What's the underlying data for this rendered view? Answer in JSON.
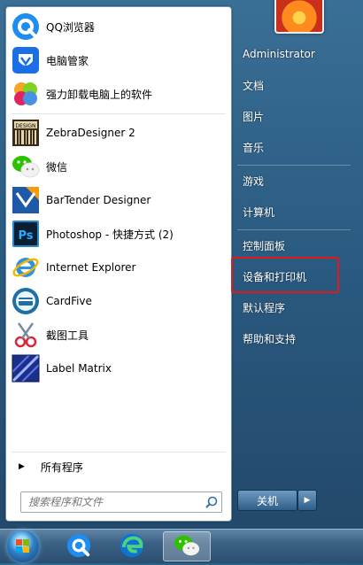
{
  "left_panel": {
    "pinned": [
      {
        "label": "QQ浏览器",
        "icon": "qq-browser-icon"
      },
      {
        "label": "电脑管家",
        "icon": "pc-manager-icon"
      },
      {
        "label": "强力卸载电脑上的软件",
        "icon": "uninstaller-icon"
      }
    ],
    "recent": [
      {
        "label": "ZebraDesigner 2",
        "icon": "zebra-designer-icon"
      },
      {
        "label": "微信",
        "icon": "wechat-icon"
      },
      {
        "label": "BarTender Designer",
        "icon": "bartender-icon"
      },
      {
        "label": "Photoshop - 快捷方式 (2)",
        "icon": "photoshop-icon"
      },
      {
        "label": "Internet Explorer",
        "icon": "internet-explorer-icon"
      },
      {
        "label": "CardFive",
        "icon": "cardfive-icon"
      },
      {
        "label": "截图工具",
        "icon": "snipping-tool-icon"
      },
      {
        "label": "Label Matrix",
        "icon": "label-matrix-icon"
      }
    ],
    "all_programs_label": "所有程序",
    "search_placeholder": "搜索程序和文件"
  },
  "right_panel": {
    "items": [
      {
        "label": "Administrator"
      },
      {
        "label": "文档"
      },
      {
        "label": "图片"
      },
      {
        "label": "音乐"
      },
      {
        "label": "游戏"
      },
      {
        "label": "计算机"
      },
      {
        "label": "控制面板"
      },
      {
        "label": "设备和打印机"
      },
      {
        "label": "默认程序"
      },
      {
        "label": "帮助和支持"
      }
    ],
    "highlighted_item": "设备和打印机",
    "shutdown_label": "关机"
  },
  "taskbar": {
    "buttons": [
      "start-orb",
      "qq-browser",
      "edge",
      "wechat"
    ],
    "active": "wechat"
  },
  "colors": {
    "highlight_border": "#e31818",
    "menu_blue": "#2a5a80"
  }
}
